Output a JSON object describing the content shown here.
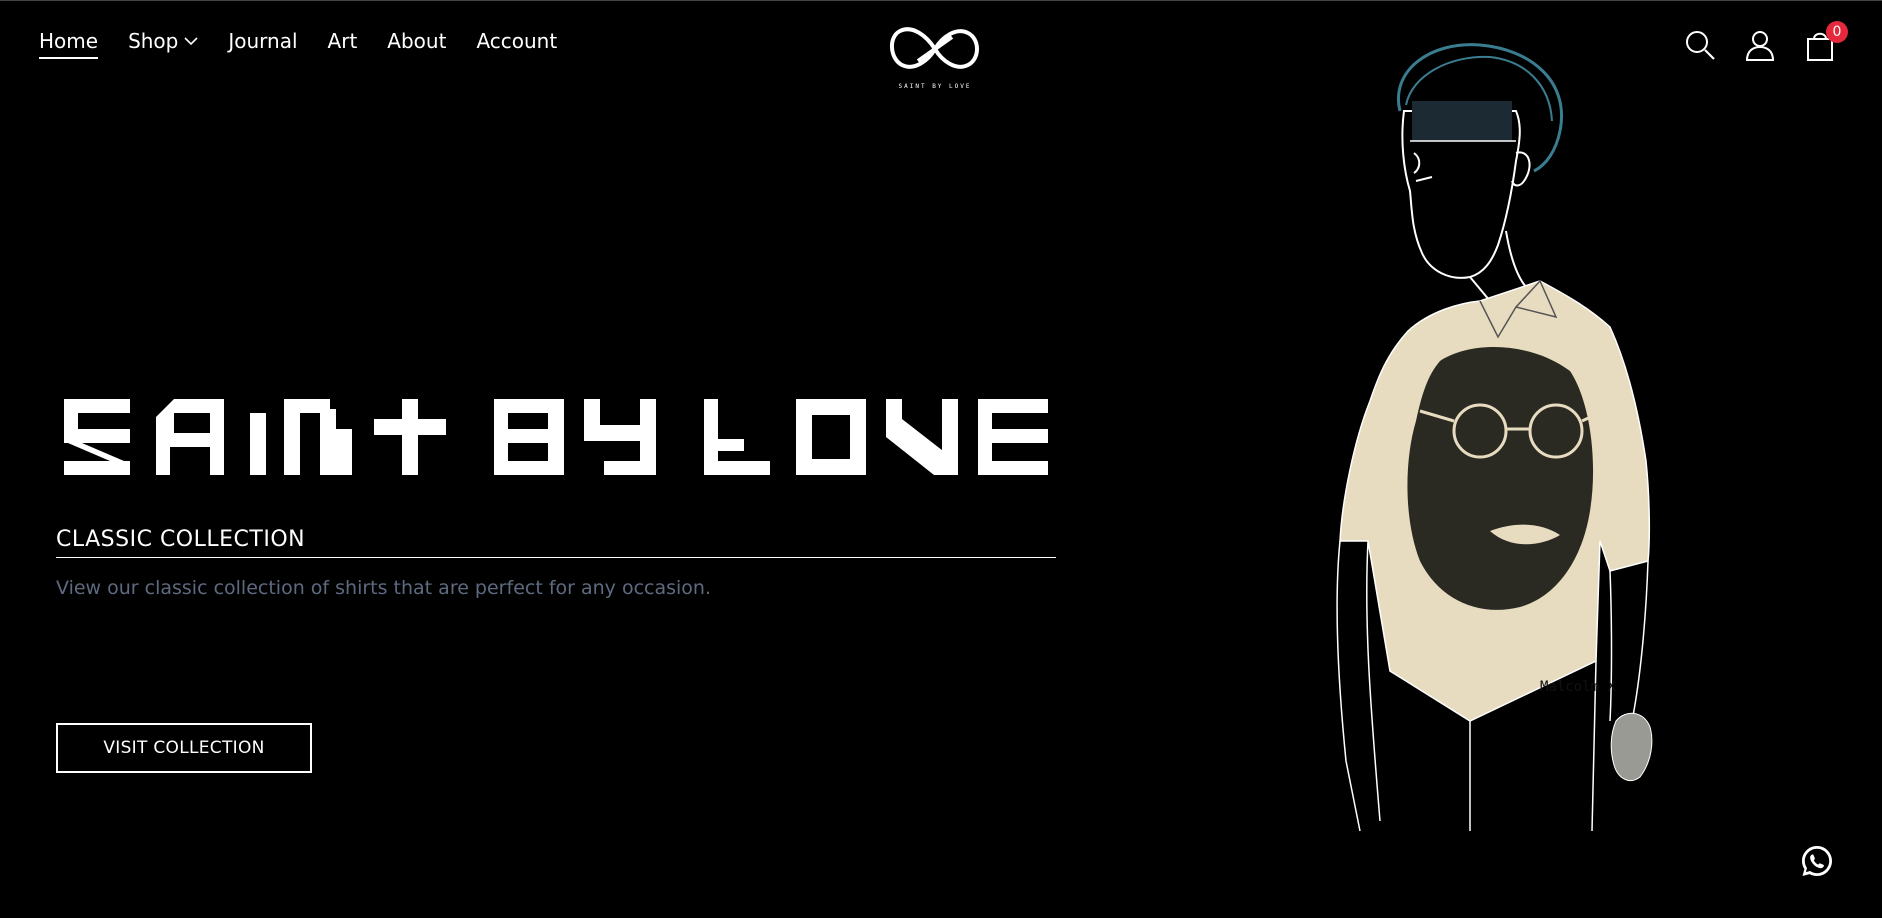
{
  "nav": {
    "items": [
      {
        "label": "Home",
        "active": true
      },
      {
        "label": "Shop",
        "has_dropdown": true
      },
      {
        "label": "Journal"
      },
      {
        "label": "Art"
      },
      {
        "label": "About"
      },
      {
        "label": "Account"
      }
    ]
  },
  "brand": {
    "logo_text": "SAINT BY LOVE",
    "logo_icon": "infinity-icon"
  },
  "header_icons": {
    "search": "search-icon",
    "account": "user-icon",
    "cart": "cart-icon",
    "cart_count": "0",
    "badge_color": "#e5283c"
  },
  "hero": {
    "title": "SAINT BY LOVE",
    "heading": "CLASSIC COLLECTION",
    "description": "View our classic collection of shirts that are perfect for any occasion.",
    "cta_label": "VISIT COLLECTION",
    "description_color": "#5e6a80",
    "shirt_print_text": "Malcolm X"
  },
  "floating": {
    "whatsapp": "whatsapp-icon"
  }
}
